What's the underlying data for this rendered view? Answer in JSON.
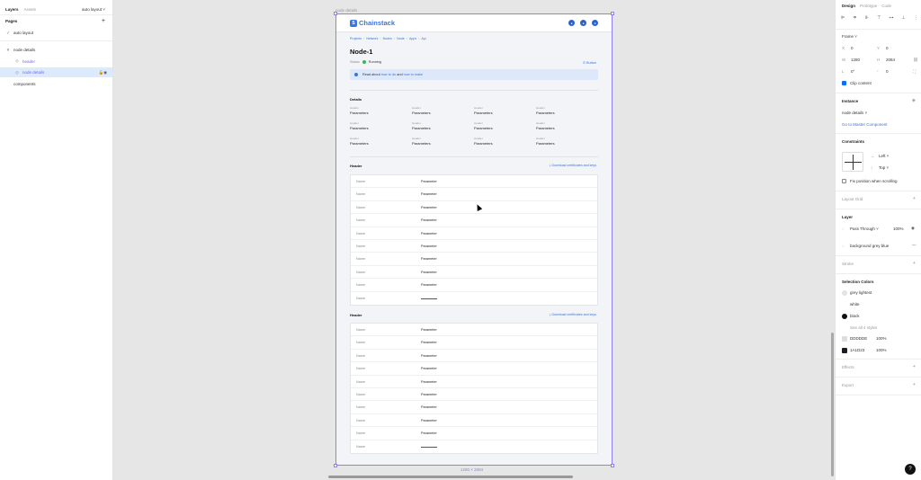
{
  "left": {
    "tabs": {
      "layers": "Layers",
      "assets": "Assets"
    },
    "page_dropdown": "auto layout ˅",
    "pages_title": "Pages",
    "pages": [
      {
        "icon": "✓",
        "label": "auto layout"
      }
    ],
    "layers": [
      {
        "icon": "#",
        "label": "node details",
        "indent": 0,
        "selected": false
      },
      {
        "icon": "◇",
        "label": "header",
        "indent": 1,
        "selected": false
      },
      {
        "icon": "◇",
        "label": "node details",
        "indent": 1,
        "selected": true
      },
      {
        "icon": " ",
        "label": "components",
        "indent": 0,
        "selected": false
      }
    ]
  },
  "canvas": {
    "frame_label": "node details",
    "size_label": "1280 × 2084",
    "app": {
      "logo": "Chainstack",
      "breadcrumbs": [
        "Projects",
        "Network",
        "Nodes",
        "Node",
        "Apps",
        "Api"
      ],
      "title": "Node-1",
      "status_label": "Status",
      "status_value": "Running",
      "button": "Button",
      "notice": {
        "prefix": "Read about",
        "link1": "how to do",
        "mid": "and",
        "link2": "how to make"
      },
      "details_title": "Details",
      "detail_key": "Header",
      "detail_value": "Parameters",
      "section_header": "Header",
      "download": "Download certificates and keys",
      "row_name": "Name",
      "row_value": "Parameter"
    }
  },
  "right": {
    "tabs": {
      "design": "Design",
      "prototype": "Prototype",
      "code": "Code"
    },
    "frame_title": "Frame ˅",
    "x_label": "X",
    "x": "0",
    "y_label": "Y",
    "y": "0",
    "w_label": "W",
    "w": "1280",
    "h_label": "H",
    "h": "2084",
    "r_label": "L",
    "r": "0°",
    "radius": "0",
    "clip": "Clip content",
    "instance_title": "Instance",
    "instance_name": "node details ˅",
    "master_link": "Go to Master Component",
    "constraints_title": "Constraints",
    "constraint_h": "Left ˅",
    "constraint_v": "Top ˅",
    "fix_position": "Fix position when scrolling",
    "layout_grid": "Layout Grid",
    "layer_title": "Layer",
    "blend": "Pass Through ˅",
    "opacity": "100%",
    "fill_style": "background grey blue",
    "stroke": "Stroke",
    "selection_colors": "Selection Colors",
    "colors": [
      {
        "name": "grey lightest",
        "hex": "#e4e4e4"
      },
      {
        "name": "white",
        "hex": "#ffffff"
      },
      {
        "name": "black",
        "hex": "#111111"
      }
    ],
    "see_all": "See all 4 styles",
    "hex_colors": [
      {
        "hex": "DDDDDE",
        "swatch": "#dddddd",
        "pct": "100%"
      },
      {
        "hex": "1A1D23",
        "swatch": "#1a1d23",
        "pct": "100%"
      }
    ],
    "effects": "Effects",
    "export": "Export"
  },
  "help": "?"
}
